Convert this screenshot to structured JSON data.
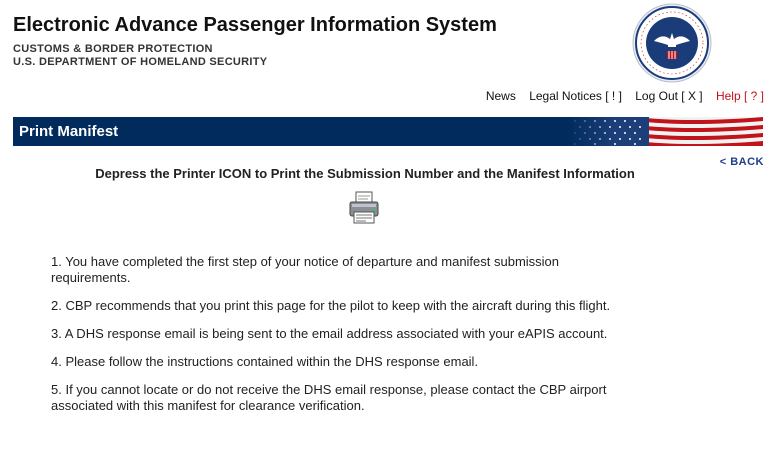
{
  "header": {
    "title": "Electronic Advance Passenger Information System",
    "subtitle1": "CUSTOMS & BORDER PROTECTION",
    "subtitle2": "U.S. DEPARTMENT OF HOMELAND SECURITY"
  },
  "nav": {
    "news": "News",
    "legal": "Legal Notices [ ! ]",
    "logout": "Log Out [ X ]",
    "help": "Help [ ? ]"
  },
  "section": {
    "title": "Print Manifest",
    "back": "< BACK"
  },
  "main": {
    "headline": "Depress the Printer ICON to Print the Submission Number and the Manifest Information",
    "steps": [
      "1. You have completed the first step of your notice of departure and manifest submission requirements.",
      "2. CBP recommends that you print this page for the pilot to keep with the aircraft during this flight.",
      "3. A DHS response email is being sent to the email address associated with your eAPIS account.",
      "4. Please follow the instructions contained within the DHS response email.",
      "5. If you cannot locate or do not receive the DHS email response, please contact the CBP airport associated with this manifest for clearance verification."
    ]
  },
  "icons": {
    "seal": "cbp-seal-icon",
    "flag": "us-flag-icon",
    "printer": "printer-icon"
  },
  "colors": {
    "bar": "#002b5c",
    "help": "#c0131b",
    "back": "#1f3f8a"
  }
}
